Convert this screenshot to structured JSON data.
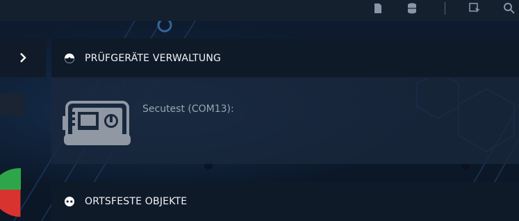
{
  "panels": {
    "device_management": {
      "title": "PRÜFGERÄTE VERWALTUNG"
    },
    "fixed_objects": {
      "title": "ORTSFESTE OBJEKTE"
    }
  },
  "devices": [
    {
      "label": "Secutest (COM13):",
      "icon": "secutest-device-icon"
    }
  ],
  "toolbar_icons": [
    "document-icon",
    "database-icon",
    "window-cursor-icon",
    "search-icon"
  ],
  "colors": {
    "background": "#0b1626",
    "header": "#0f1a29",
    "panel_body": "#1a283c",
    "device_label": "#9ba6b3"
  }
}
